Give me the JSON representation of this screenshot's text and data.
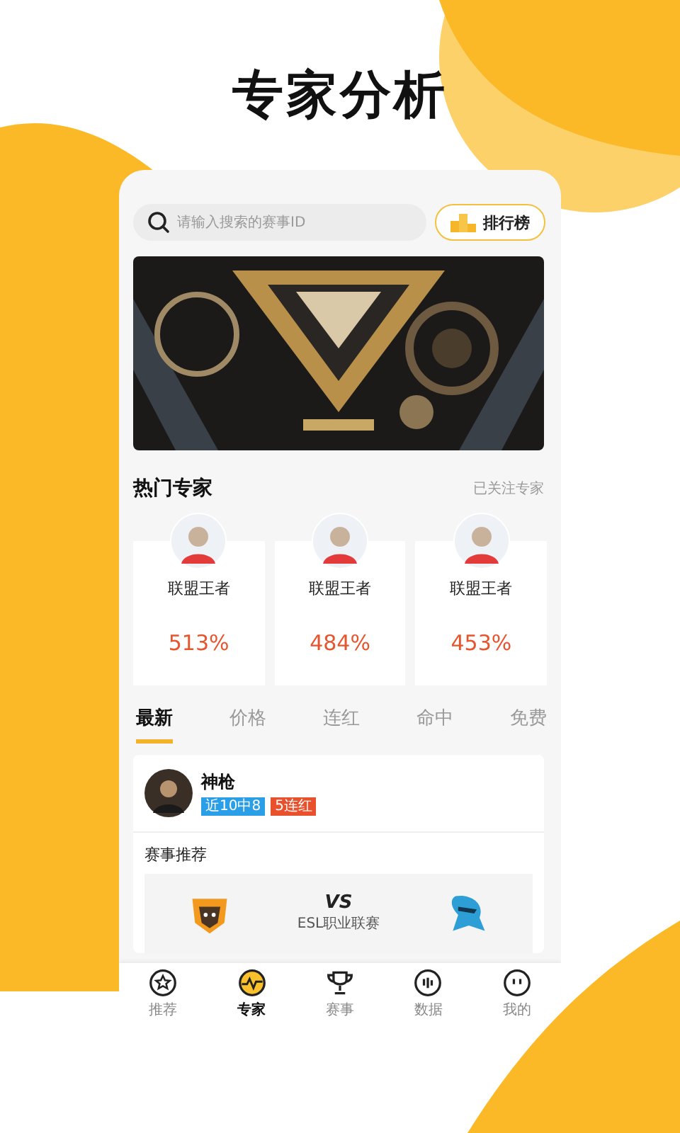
{
  "headline": "专家分析",
  "search": {
    "placeholder": "请输入搜索的赛事ID"
  },
  "ranking_button": {
    "label": "排行榜"
  },
  "hot_experts": {
    "title": "热门专家",
    "link": "已关注专家",
    "experts": [
      {
        "name": "联盟王者",
        "rate": "513%"
      },
      {
        "name": "联盟王者",
        "rate": "484%"
      },
      {
        "name": "联盟王者",
        "rate": "453%"
      }
    ]
  },
  "tabs": [
    {
      "label": "最新",
      "selected": true
    },
    {
      "label": "价格",
      "selected": false
    },
    {
      "label": "连红",
      "selected": false
    },
    {
      "label": "命中",
      "selected": false
    },
    {
      "label": "免费",
      "selected": false
    }
  ],
  "expert_post": {
    "name": "神枪",
    "tags": [
      {
        "text": "近10中8",
        "color": "#2a9ee6"
      },
      {
        "text": "5连红",
        "color": "#e9502c"
      }
    ]
  },
  "match": {
    "section_title": "赛事推荐",
    "vs": "VS",
    "league": "ESL职业联赛"
  },
  "nav": [
    {
      "label": "推荐",
      "kind": "star",
      "selected": false
    },
    {
      "label": "专家",
      "kind": "pulse",
      "selected": true
    },
    {
      "label": "赛事",
      "kind": "trophy",
      "selected": false
    },
    {
      "label": "数据",
      "kind": "bars",
      "selected": false
    },
    {
      "label": "我的",
      "kind": "face",
      "selected": false
    }
  ]
}
